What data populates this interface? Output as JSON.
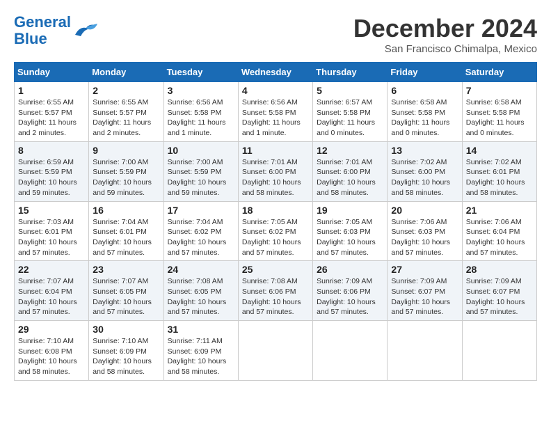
{
  "logo": {
    "line1": "General",
    "line2": "Blue"
  },
  "title": "December 2024",
  "subtitle": "San Francisco Chimalpa, Mexico",
  "headers": [
    "Sunday",
    "Monday",
    "Tuesday",
    "Wednesday",
    "Thursday",
    "Friday",
    "Saturday"
  ],
  "weeks": [
    [
      {
        "day": "1",
        "info": "Sunrise: 6:55 AM\nSunset: 5:57 PM\nDaylight: 11 hours\nand 2 minutes."
      },
      {
        "day": "2",
        "info": "Sunrise: 6:55 AM\nSunset: 5:57 PM\nDaylight: 11 hours\nand 2 minutes."
      },
      {
        "day": "3",
        "info": "Sunrise: 6:56 AM\nSunset: 5:58 PM\nDaylight: 11 hours\nand 1 minute."
      },
      {
        "day": "4",
        "info": "Sunrise: 6:56 AM\nSunset: 5:58 PM\nDaylight: 11 hours\nand 1 minute."
      },
      {
        "day": "5",
        "info": "Sunrise: 6:57 AM\nSunset: 5:58 PM\nDaylight: 11 hours\nand 0 minutes."
      },
      {
        "day": "6",
        "info": "Sunrise: 6:58 AM\nSunset: 5:58 PM\nDaylight: 11 hours\nand 0 minutes."
      },
      {
        "day": "7",
        "info": "Sunrise: 6:58 AM\nSunset: 5:58 PM\nDaylight: 11 hours\nand 0 minutes."
      }
    ],
    [
      {
        "day": "8",
        "info": "Sunrise: 6:59 AM\nSunset: 5:59 PM\nDaylight: 10 hours\nand 59 minutes."
      },
      {
        "day": "9",
        "info": "Sunrise: 7:00 AM\nSunset: 5:59 PM\nDaylight: 10 hours\nand 59 minutes."
      },
      {
        "day": "10",
        "info": "Sunrise: 7:00 AM\nSunset: 5:59 PM\nDaylight: 10 hours\nand 59 minutes."
      },
      {
        "day": "11",
        "info": "Sunrise: 7:01 AM\nSunset: 6:00 PM\nDaylight: 10 hours\nand 58 minutes."
      },
      {
        "day": "12",
        "info": "Sunrise: 7:01 AM\nSunset: 6:00 PM\nDaylight: 10 hours\nand 58 minutes."
      },
      {
        "day": "13",
        "info": "Sunrise: 7:02 AM\nSunset: 6:00 PM\nDaylight: 10 hours\nand 58 minutes."
      },
      {
        "day": "14",
        "info": "Sunrise: 7:02 AM\nSunset: 6:01 PM\nDaylight: 10 hours\nand 58 minutes."
      }
    ],
    [
      {
        "day": "15",
        "info": "Sunrise: 7:03 AM\nSunset: 6:01 PM\nDaylight: 10 hours\nand 57 minutes."
      },
      {
        "day": "16",
        "info": "Sunrise: 7:04 AM\nSunset: 6:01 PM\nDaylight: 10 hours\nand 57 minutes."
      },
      {
        "day": "17",
        "info": "Sunrise: 7:04 AM\nSunset: 6:02 PM\nDaylight: 10 hours\nand 57 minutes."
      },
      {
        "day": "18",
        "info": "Sunrise: 7:05 AM\nSunset: 6:02 PM\nDaylight: 10 hours\nand 57 minutes."
      },
      {
        "day": "19",
        "info": "Sunrise: 7:05 AM\nSunset: 6:03 PM\nDaylight: 10 hours\nand 57 minutes."
      },
      {
        "day": "20",
        "info": "Sunrise: 7:06 AM\nSunset: 6:03 PM\nDaylight: 10 hours\nand 57 minutes."
      },
      {
        "day": "21",
        "info": "Sunrise: 7:06 AM\nSunset: 6:04 PM\nDaylight: 10 hours\nand 57 minutes."
      }
    ],
    [
      {
        "day": "22",
        "info": "Sunrise: 7:07 AM\nSunset: 6:04 PM\nDaylight: 10 hours\nand 57 minutes."
      },
      {
        "day": "23",
        "info": "Sunrise: 7:07 AM\nSunset: 6:05 PM\nDaylight: 10 hours\nand 57 minutes."
      },
      {
        "day": "24",
        "info": "Sunrise: 7:08 AM\nSunset: 6:05 PM\nDaylight: 10 hours\nand 57 minutes."
      },
      {
        "day": "25",
        "info": "Sunrise: 7:08 AM\nSunset: 6:06 PM\nDaylight: 10 hours\nand 57 minutes."
      },
      {
        "day": "26",
        "info": "Sunrise: 7:09 AM\nSunset: 6:06 PM\nDaylight: 10 hours\nand 57 minutes."
      },
      {
        "day": "27",
        "info": "Sunrise: 7:09 AM\nSunset: 6:07 PM\nDaylight: 10 hours\nand 57 minutes."
      },
      {
        "day": "28",
        "info": "Sunrise: 7:09 AM\nSunset: 6:07 PM\nDaylight: 10 hours\nand 57 minutes."
      }
    ],
    [
      {
        "day": "29",
        "info": "Sunrise: 7:10 AM\nSunset: 6:08 PM\nDaylight: 10 hours\nand 58 minutes."
      },
      {
        "day": "30",
        "info": "Sunrise: 7:10 AM\nSunset: 6:09 PM\nDaylight: 10 hours\nand 58 minutes."
      },
      {
        "day": "31",
        "info": "Sunrise: 7:11 AM\nSunset: 6:09 PM\nDaylight: 10 hours\nand 58 minutes."
      },
      {
        "day": "",
        "info": ""
      },
      {
        "day": "",
        "info": ""
      },
      {
        "day": "",
        "info": ""
      },
      {
        "day": "",
        "info": ""
      }
    ]
  ]
}
